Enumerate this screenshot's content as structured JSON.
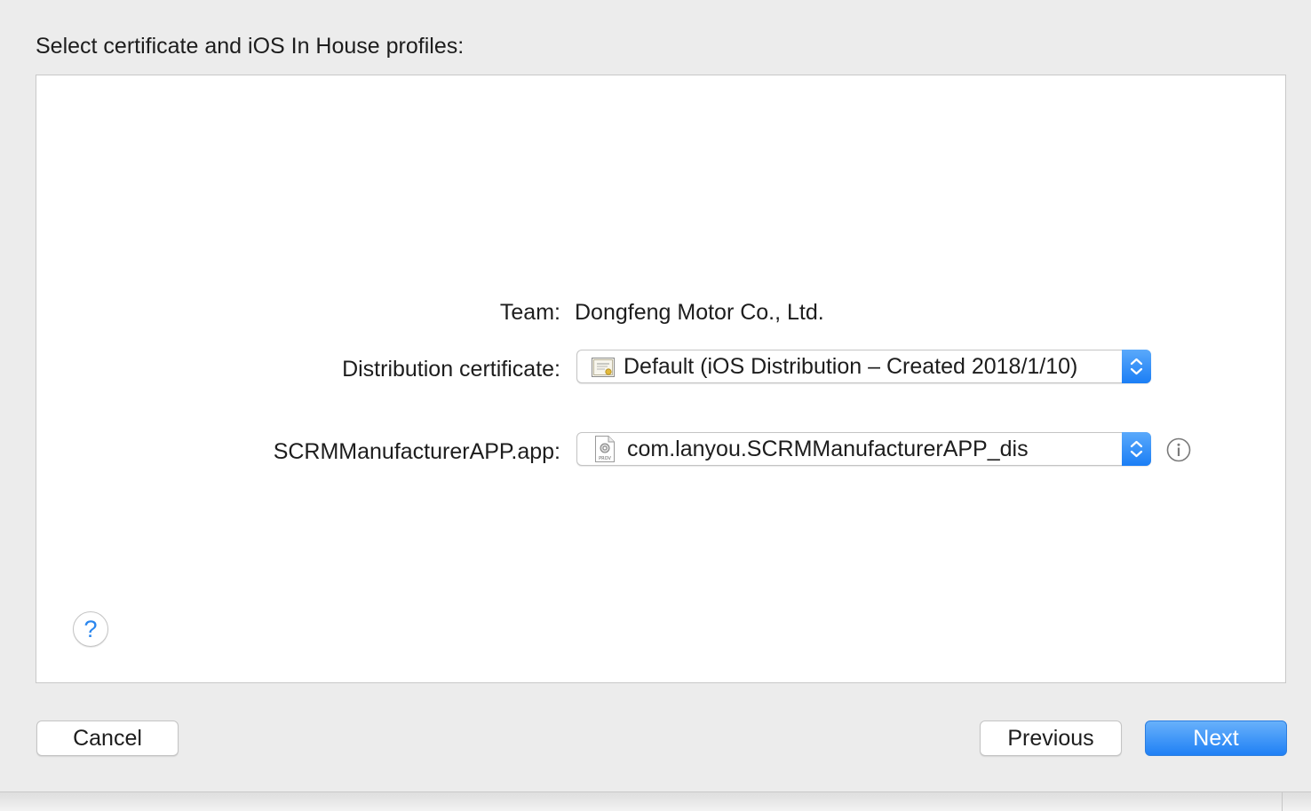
{
  "window": {
    "heading": "Select certificate and iOS In House profiles:"
  },
  "form": {
    "team": {
      "label": "Team:",
      "value": "Dongfeng Motor Co., Ltd."
    },
    "distribution_certificate": {
      "label": "Distribution certificate:",
      "selected": "Default (iOS Distribution – Created 2018/1/10)",
      "icon": "certificate-icon"
    },
    "app_profile": {
      "label": "SCRMManufacturerAPP.app:",
      "selected": "com.lanyou.SCRMManufacturerAPP_dis",
      "icon": "provisioning-profile-icon",
      "icon_caption": "PROV"
    }
  },
  "footer": {
    "help_label": "?",
    "cancel_label": "Cancel",
    "previous_label": "Previous",
    "next_label": "Next"
  },
  "colors": {
    "accent": "#1f80f5",
    "background": "#ececec",
    "panel": "#ffffff"
  }
}
